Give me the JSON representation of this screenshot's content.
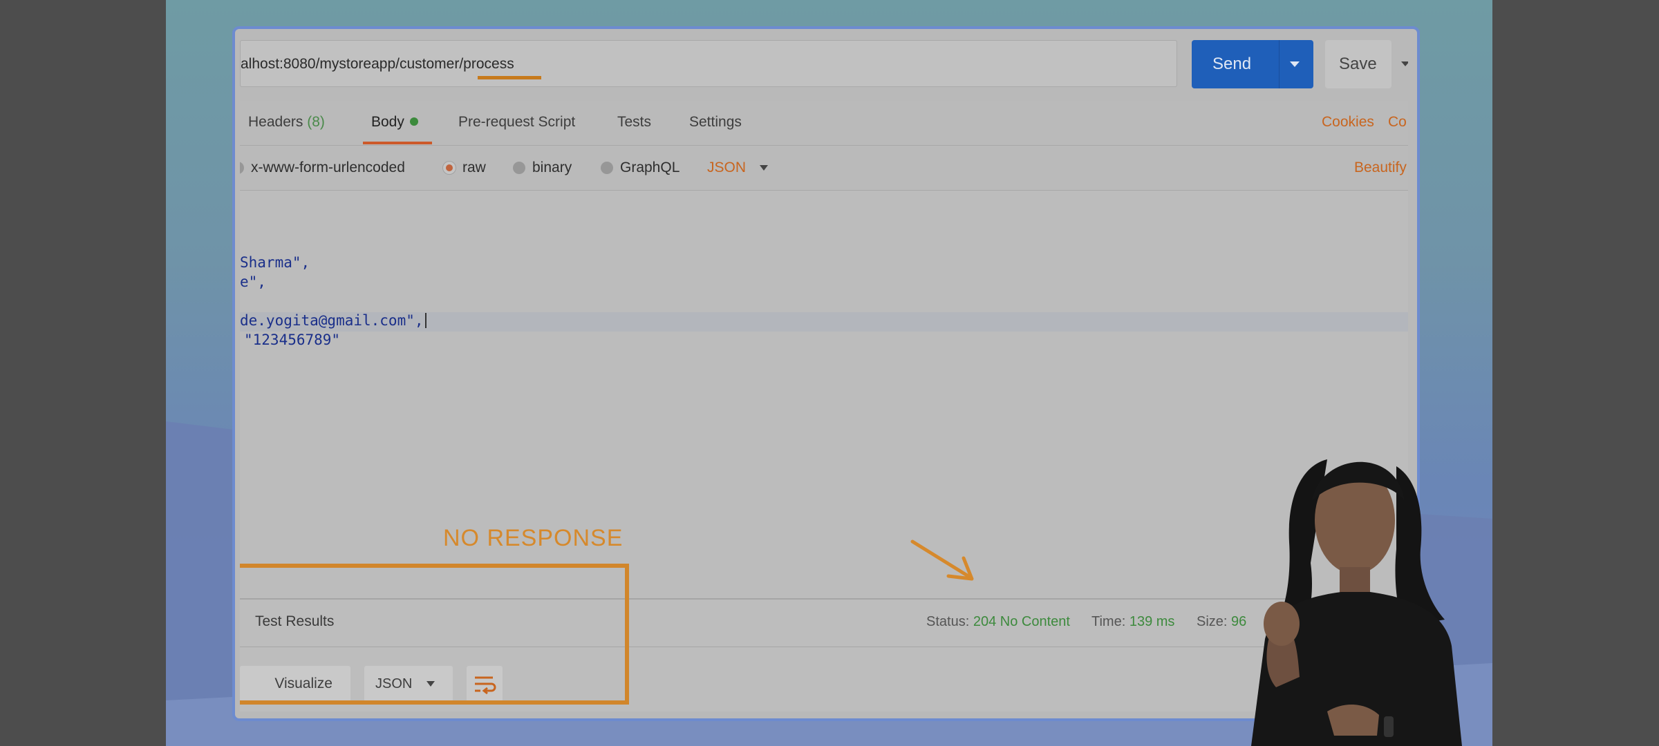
{
  "request": {
    "url": "alhost:8080/mystoreapp/customer/process",
    "send_label": "Send",
    "save_label": "Save"
  },
  "tabs": [
    {
      "label": "Headers",
      "count": "(8)"
    },
    {
      "label": "Body"
    },
    {
      "label": "Pre-request Script"
    },
    {
      "label": "Tests"
    },
    {
      "label": "Settings"
    }
  ],
  "right_links": {
    "cookies": "Cookies",
    "code": "Co"
  },
  "body_options": {
    "urlencoded": "x-www-form-urlencoded",
    "raw": "raw",
    "binary": "binary",
    "graphql": "GraphQL",
    "format": "JSON",
    "beautify": "Beautify"
  },
  "editor": {
    "line1": "Sharma\",",
    "line2": "e\",",
    "line3": "de.yogita@gmail.com\",",
    "line4": "\"123456789\""
  },
  "response": {
    "test_results": "Test Results",
    "status_label": "Status:",
    "status_value": "204 No Content",
    "time_label": "Time:",
    "time_value": "139 ms",
    "size_label": "Size:",
    "size_value": "96",
    "visualize": "Visualize",
    "format": "JSON"
  },
  "annotation": {
    "no_response": "NO RESPONSE"
  },
  "colors": {
    "accent_orange": "#d6892c",
    "send_blue": "#1f5fb9",
    "status_green": "#3d8a3d"
  }
}
